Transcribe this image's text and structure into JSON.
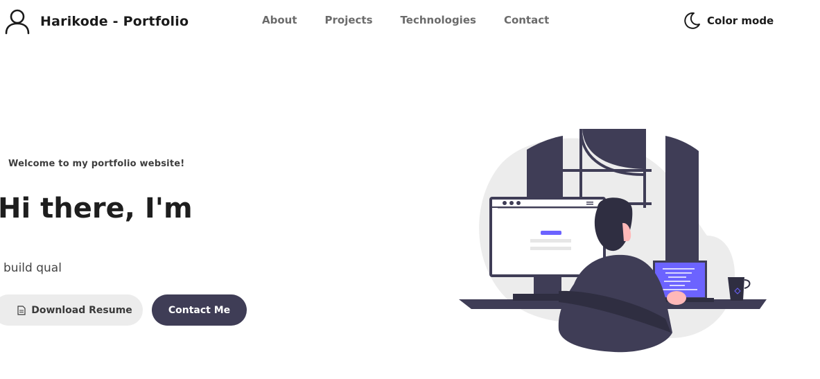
{
  "brand": {
    "name": "Harikode - Portfolio",
    "icon": "user-icon"
  },
  "nav": {
    "links": [
      "About",
      "Projects",
      "Technologies",
      "Contact"
    ]
  },
  "color_mode": {
    "label": "Color mode",
    "icon": "moon-icon"
  },
  "hero": {
    "welcome": "Welcome to my portfolio website!",
    "title": "Hi there, I'm",
    "typed_text": " build qual"
  },
  "buttons": {
    "download_resume": "Download Resume",
    "download_icon": "document-icon",
    "contact_me": "Contact Me"
  },
  "colors": {
    "accent_dark": "#3f3d56",
    "accent_purple": "#6c63ff",
    "button_light": "#ececec"
  }
}
